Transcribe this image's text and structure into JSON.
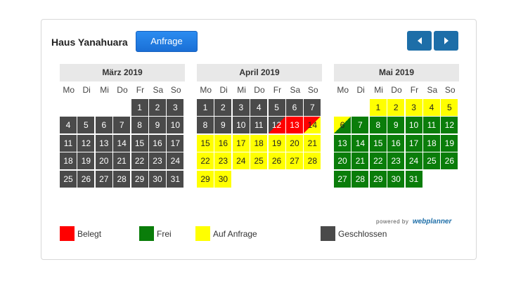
{
  "header": {
    "title": "Haus Yanahuara",
    "request_label": "Anfrage"
  },
  "weekdays": [
    "Mo",
    "Di",
    "Mi",
    "Do",
    "Fr",
    "Sa",
    "So"
  ],
  "months": [
    {
      "name": "März 2019",
      "offset": 4,
      "days": [
        {
          "d": "1",
          "s": "closed"
        },
        {
          "d": "2",
          "s": "closed"
        },
        {
          "d": "3",
          "s": "closed"
        },
        {
          "d": "4",
          "s": "closed"
        },
        {
          "d": "5",
          "s": "closed"
        },
        {
          "d": "6",
          "s": "closed"
        },
        {
          "d": "7",
          "s": "closed"
        },
        {
          "d": "8",
          "s": "closed"
        },
        {
          "d": "9",
          "s": "closed"
        },
        {
          "d": "10",
          "s": "closed"
        },
        {
          "d": "11",
          "s": "closed"
        },
        {
          "d": "12",
          "s": "closed"
        },
        {
          "d": "13",
          "s": "closed"
        },
        {
          "d": "14",
          "s": "closed"
        },
        {
          "d": "15",
          "s": "closed"
        },
        {
          "d": "16",
          "s": "closed"
        },
        {
          "d": "17",
          "s": "closed"
        },
        {
          "d": "18",
          "s": "closed"
        },
        {
          "d": "19",
          "s": "closed"
        },
        {
          "d": "20",
          "s": "closed"
        },
        {
          "d": "21",
          "s": "closed"
        },
        {
          "d": "22",
          "s": "closed"
        },
        {
          "d": "23",
          "s": "closed"
        },
        {
          "d": "24",
          "s": "closed"
        },
        {
          "d": "25",
          "s": "closed"
        },
        {
          "d": "26",
          "s": "closed"
        },
        {
          "d": "27",
          "s": "closed"
        },
        {
          "d": "28",
          "s": "closed"
        },
        {
          "d": "29",
          "s": "closed"
        },
        {
          "d": "30",
          "s": "closed"
        },
        {
          "d": "31",
          "s": "closed"
        }
      ]
    },
    {
      "name": "April 2019",
      "offset": 0,
      "days": [
        {
          "d": "1",
          "s": "closed"
        },
        {
          "d": "2",
          "s": "closed"
        },
        {
          "d": "3",
          "s": "closed"
        },
        {
          "d": "4",
          "s": "closed"
        },
        {
          "d": "5",
          "s": "closed"
        },
        {
          "d": "6",
          "s": "closed"
        },
        {
          "d": "7",
          "s": "closed"
        },
        {
          "d": "8",
          "s": "closed"
        },
        {
          "d": "9",
          "s": "closed"
        },
        {
          "d": "10",
          "s": "closed"
        },
        {
          "d": "11",
          "s": "closed"
        },
        {
          "d": "12",
          "s": "closed-booked"
        },
        {
          "d": "13",
          "s": "booked"
        },
        {
          "d": "14",
          "s": "booked-request"
        },
        {
          "d": "15",
          "s": "request"
        },
        {
          "d": "16",
          "s": "request"
        },
        {
          "d": "17",
          "s": "request"
        },
        {
          "d": "18",
          "s": "request"
        },
        {
          "d": "19",
          "s": "request"
        },
        {
          "d": "20",
          "s": "request"
        },
        {
          "d": "21",
          "s": "request"
        },
        {
          "d": "22",
          "s": "request"
        },
        {
          "d": "23",
          "s": "request"
        },
        {
          "d": "24",
          "s": "request"
        },
        {
          "d": "25",
          "s": "request"
        },
        {
          "d": "26",
          "s": "request"
        },
        {
          "d": "27",
          "s": "request"
        },
        {
          "d": "28",
          "s": "request"
        },
        {
          "d": "29",
          "s": "request"
        },
        {
          "d": "30",
          "s": "request"
        }
      ]
    },
    {
      "name": "Mai 2019",
      "offset": 2,
      "days": [
        {
          "d": "1",
          "s": "request"
        },
        {
          "d": "2",
          "s": "request"
        },
        {
          "d": "3",
          "s": "request"
        },
        {
          "d": "4",
          "s": "request"
        },
        {
          "d": "5",
          "s": "request"
        },
        {
          "d": "6",
          "s": "request-free"
        },
        {
          "d": "7",
          "s": "free"
        },
        {
          "d": "8",
          "s": "free"
        },
        {
          "d": "9",
          "s": "free"
        },
        {
          "d": "10",
          "s": "free"
        },
        {
          "d": "11",
          "s": "free"
        },
        {
          "d": "12",
          "s": "free"
        },
        {
          "d": "13",
          "s": "free"
        },
        {
          "d": "14",
          "s": "free"
        },
        {
          "d": "15",
          "s": "free"
        },
        {
          "d": "16",
          "s": "free"
        },
        {
          "d": "17",
          "s": "free"
        },
        {
          "d": "18",
          "s": "free"
        },
        {
          "d": "19",
          "s": "free"
        },
        {
          "d": "20",
          "s": "free"
        },
        {
          "d": "21",
          "s": "free"
        },
        {
          "d": "22",
          "s": "free"
        },
        {
          "d": "23",
          "s": "free"
        },
        {
          "d": "24",
          "s": "free"
        },
        {
          "d": "25",
          "s": "free"
        },
        {
          "d": "26",
          "s": "free"
        },
        {
          "d": "27",
          "s": "free"
        },
        {
          "d": "28",
          "s": "free"
        },
        {
          "d": "29",
          "s": "free"
        },
        {
          "d": "30",
          "s": "free"
        },
        {
          "d": "31",
          "s": "free"
        }
      ]
    }
  ],
  "powered": {
    "prefix": "powered by",
    "brand_a": "web",
    "brand_b": "planner"
  },
  "legend": [
    {
      "label": "Belegt",
      "color": "#ff0000"
    },
    {
      "label": "Frei",
      "color": "#0a7d0a"
    },
    {
      "label": "Auf Anfrage",
      "color": "#ffff00"
    },
    {
      "label": "Geschlossen",
      "color": "#4a4a4a"
    }
  ],
  "icons": {
    "prev": "caret-left-icon",
    "next": "caret-right-icon"
  }
}
